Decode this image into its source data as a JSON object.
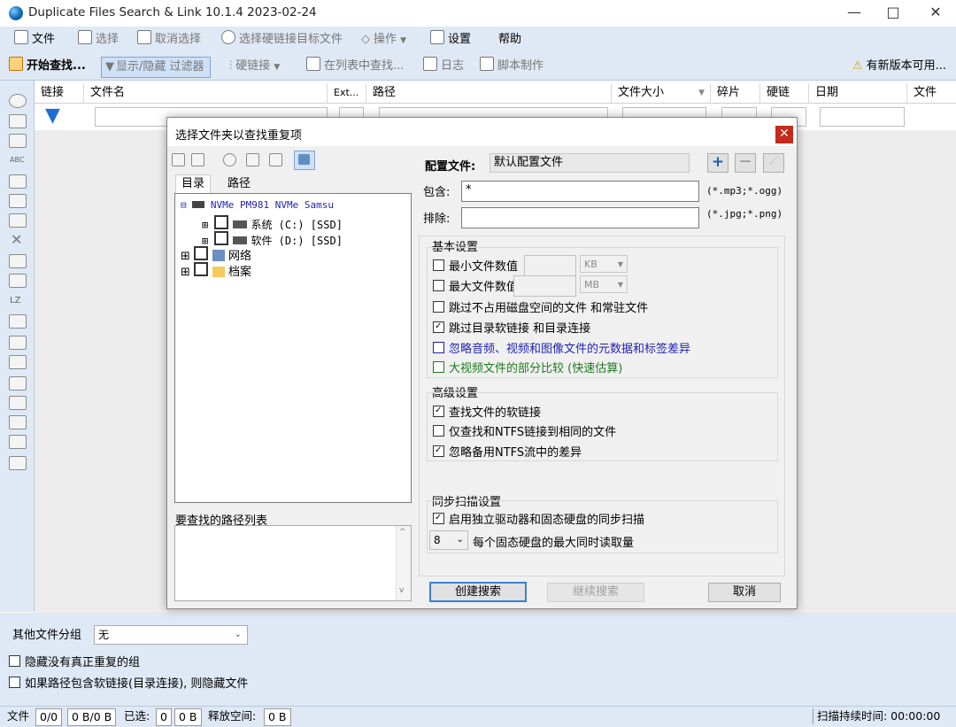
{
  "window": {
    "title": "Duplicate Files Search & Link 10.1.4 2023-02-24"
  },
  "menu": {
    "file": "文件",
    "select": "选择",
    "deselect": "取消选择",
    "select_hardlink_targets": "选择硬链接目标文件",
    "actions": "操作",
    "settings": "设置",
    "help": "帮助"
  },
  "toolbar": {
    "start_search": "开始查找...",
    "toggle_filter": "显示/隐藏 过滤器",
    "hardlink": "硬链接",
    "find_in_list": "在列表中查找...",
    "log": "日志",
    "script": "脚本制作",
    "new_version": "有新版本可用..."
  },
  "columns": [
    "链接",
    "文件名",
    "Ext...",
    "路径",
    "文件大小",
    "碎片",
    "硬链",
    "日期",
    "文件"
  ],
  "bottom": {
    "group_label": "其他文件分组",
    "group_value": "无",
    "hide_groups": "隐藏没有真正重复的组",
    "hide_symlink": "如果路径包含软链接(目录连接), 则隐藏文件"
  },
  "status": {
    "files_label": "文件",
    "files_count": "0/0",
    "files_size": "0 B/0 B",
    "selected_label": "已选:",
    "selected_count": "0",
    "selected_size": "0 B",
    "free_label": "释放空间:",
    "free_value": "0 B",
    "scan_time": "扫描持续时间: 00:00:00"
  },
  "dialog": {
    "title": "选择文件夹以查找重复项",
    "tabs": [
      "目录",
      "路径"
    ],
    "tree": {
      "root": "NVMe PM981 NVMe Samsu",
      "drives": [
        "系统 (C:) [SSD]",
        "软件 (D:) [SSD]"
      ],
      "network": "网络",
      "archive": "档案"
    },
    "paths_label": "要查找的路径列表",
    "profile_label": "配置文件:",
    "profile_value": "默认配置文件",
    "include_label": "包含:",
    "include_value": "*",
    "include_hint": "(*.mp3;*.ogg)",
    "exclude_label": "排除:",
    "exclude_value": "",
    "exclude_hint": "(*.jpg;*.png)",
    "basic": {
      "title": "基本设置",
      "min_size": "最小文件数值",
      "max_size": "最大文件数值",
      "min_unit": "KB",
      "max_unit": "MB",
      "skip_sparse": "跳过不占用磁盘空间的文件 和常驻文件",
      "skip_links": "跳过目录软链接 和目录连接",
      "ignore_meta": "忽略音频、视频和图像文件的元数据和标签差异",
      "partial_video": "大视频文件的部分比较 (快速估算)"
    },
    "advanced": {
      "title": "高级设置",
      "find_symlinks": "查找文件的软链接",
      "only_ntfs": "仅查找和NTFS链接到相同的文件",
      "ignore_ads": "忽略备用NTFS流中的差异"
    },
    "sync": {
      "title": "同步扫描设置",
      "enable": "启用独立驱动器和固态硬盘的同步扫描",
      "max_value": "8",
      "max_label": "每个固态硬盘的最大同时读取量"
    },
    "buttons": {
      "create": "创建搜索",
      "continue": "继续搜索",
      "cancel": "取消"
    },
    "colors": {
      "blue": "#1f1fb4",
      "green": "#1e7a1e"
    }
  }
}
